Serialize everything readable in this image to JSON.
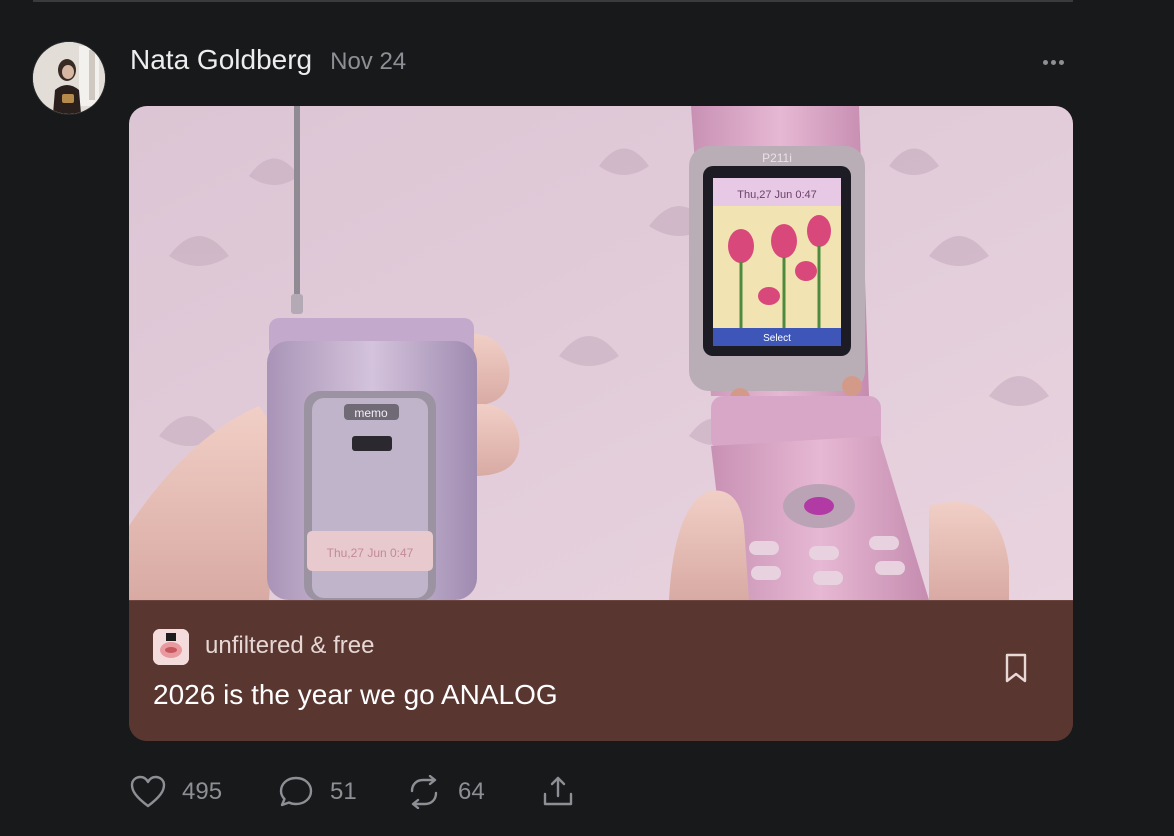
{
  "post": {
    "author": "Nata Goldberg",
    "date": "Nov 24",
    "more_icon": "more-horizontal-icon"
  },
  "card": {
    "publication": "unfiltered & free",
    "title": "2026 is the year we go ANALOG",
    "bookmark_icon": "bookmark-icon",
    "background_color": "#5a3630",
    "image": {
      "left_phone_text": [
        "memo",
        "Thu,27 Jun 0:47"
      ],
      "right_phone_text": [
        "P211i",
        "Thu,27 Jun 0:47",
        "Select"
      ]
    }
  },
  "actions": {
    "likes": "495",
    "comments": "51",
    "restacks": "64",
    "like_icon": "heart-icon",
    "comment_icon": "comment-icon",
    "restack_icon": "restack-icon",
    "share_icon": "share-icon"
  },
  "colors": {
    "background": "#18191b",
    "muted_text": "#8d8f94"
  }
}
